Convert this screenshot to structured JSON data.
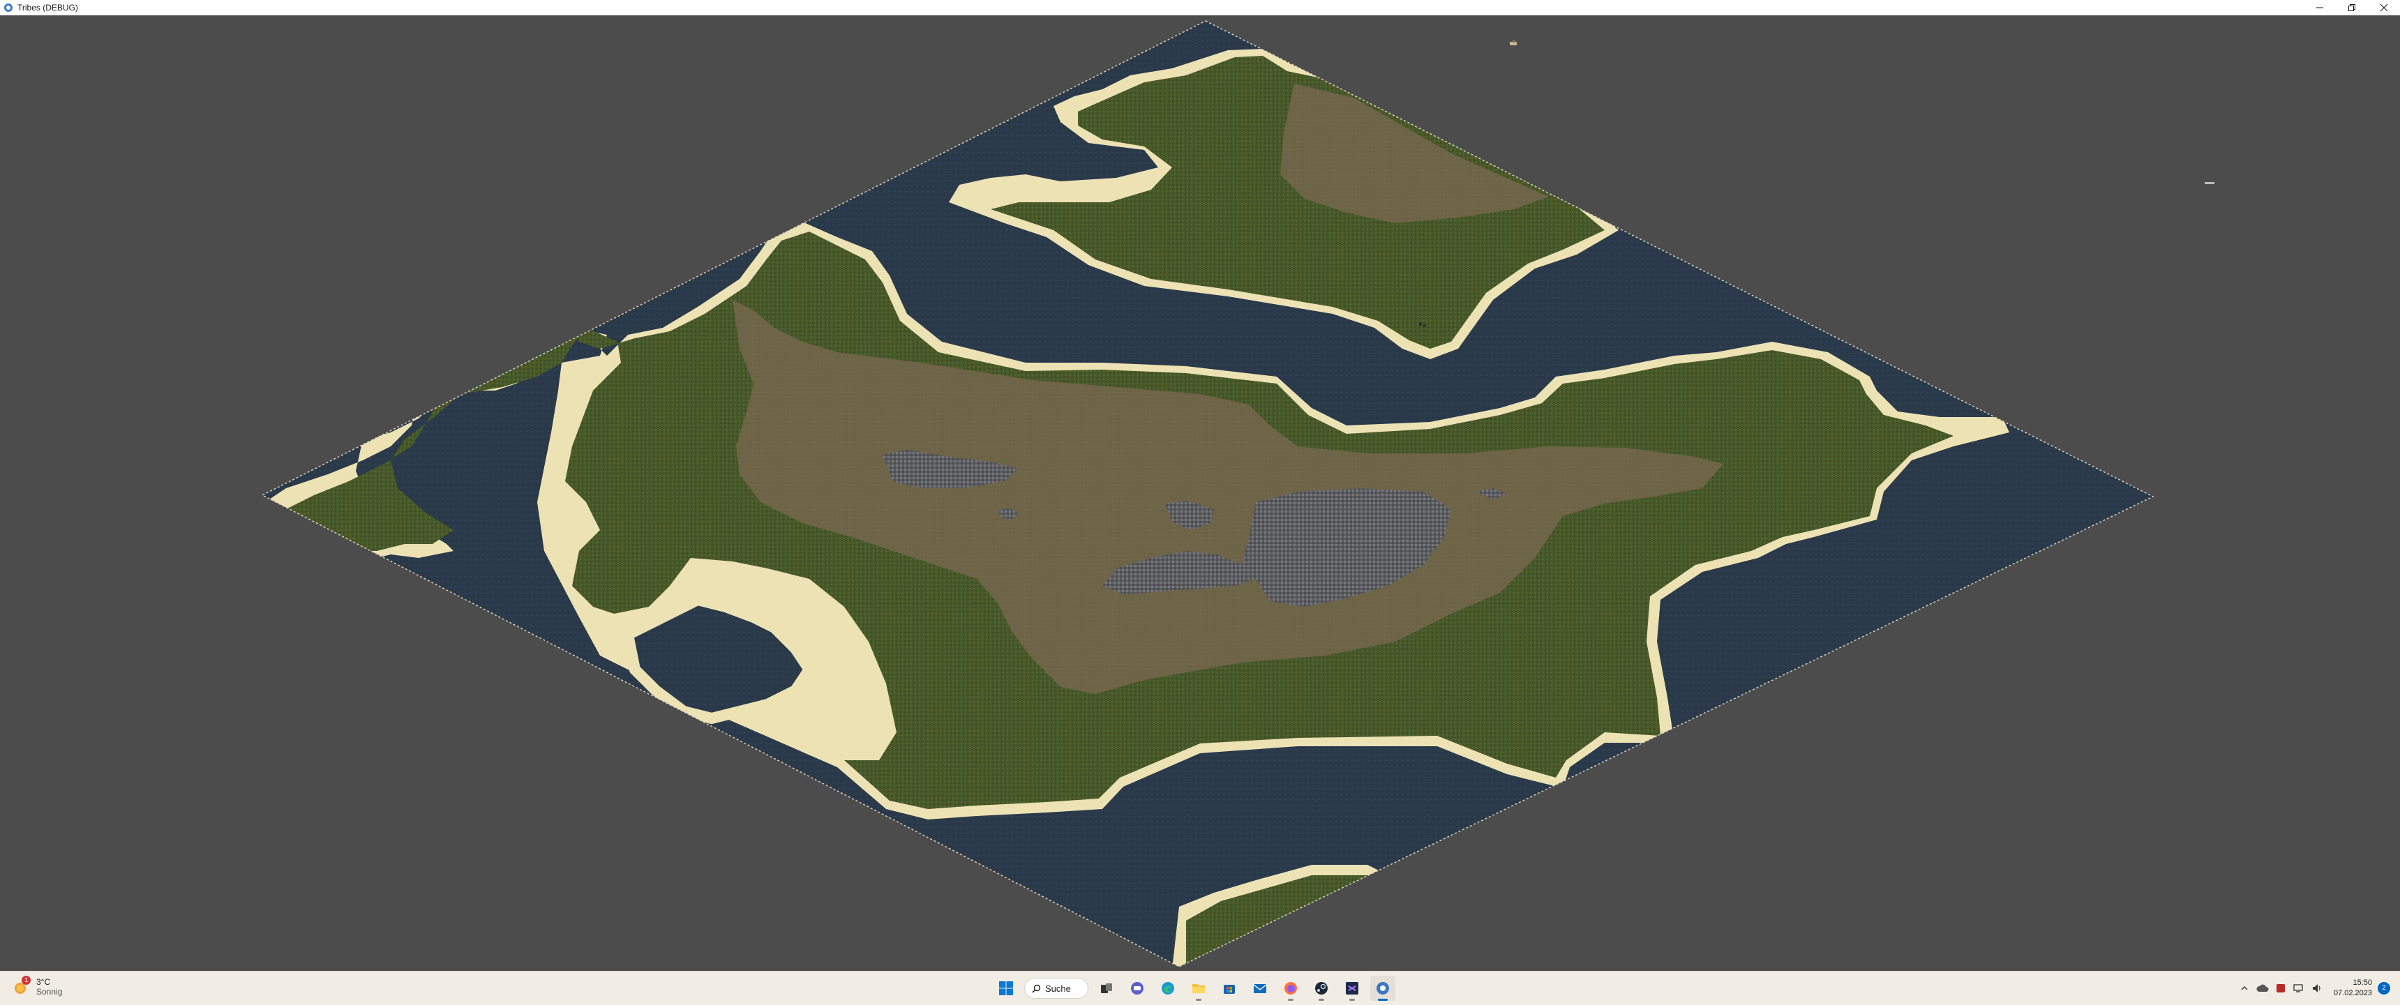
{
  "window": {
    "title": "Tribes (DEBUG)",
    "controls": [
      "minimize-icon",
      "restore-icon",
      "close-icon"
    ]
  },
  "game": {
    "view": "isometric hex terrain map",
    "terrain_colors": {
      "water": "#2b3a4a",
      "sand": "#ece2b4",
      "grass": "#47592a",
      "dirt": "#6e6447",
      "rock": "#66676a",
      "background": "#4c4c4c"
    }
  },
  "taskbar": {
    "weather": {
      "temp": "3°C",
      "condition": "Sonnig",
      "badge": "1"
    },
    "search_label": "Suche",
    "apps": [
      "start-icon",
      "search",
      "task-view-icon",
      "chat-icon",
      "edge-icon",
      "file-explorer-icon",
      "store-icon",
      "mail-icon",
      "firefox-icon",
      "steam-icon",
      "visual-studio-icon",
      "tribes-app-icon"
    ],
    "clock": {
      "time": "15:50",
      "date": "07.02.2023"
    },
    "notifications": "2"
  }
}
